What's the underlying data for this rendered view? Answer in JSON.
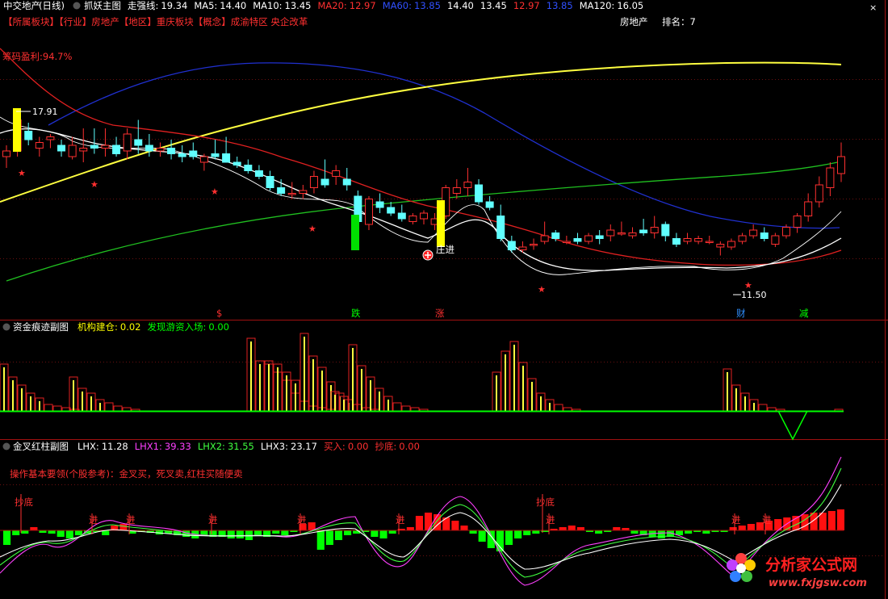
{
  "main_panel": {
    "stock_name": "中交地产",
    "period": "(日线)",
    "indicator_name": "抓妖主图",
    "stats": [
      {
        "label": "走强线:",
        "value": "19.34",
        "color": "#ffffff"
      },
      {
        "label": "MA5:",
        "value": "14.40",
        "color": "#ffffff"
      },
      {
        "label": "MA10:",
        "value": "13.45",
        "color": "#ffffff"
      },
      {
        "label": "MA20:",
        "value": "12.97",
        "color": "#ff3030"
      },
      {
        "label": "MA60:",
        "value": "13.85",
        "color": "#3050ff"
      },
      {
        "label": "",
        "value": "14.40",
        "color": "#ffffff"
      },
      {
        "label": "",
        "value": "13.45",
        "color": "#ffffff"
      },
      {
        "label": "",
        "value": "12.97",
        "color": "#ff3030"
      },
      {
        "label": "",
        "value": "13.85",
        "color": "#3050ff"
      },
      {
        "label": "MA120:",
        "value": "16.05",
        "color": "#ffffff"
      }
    ],
    "sectors_line": "【所属板块】【行业】房地产【地区】重庆板块【概念】成渝特区 央企改革",
    "industry": "房地产",
    "rank_label": "排名：7",
    "chip_profit": "筹码盈利:94.7%",
    "high_price_label": "17.91",
    "low_price_label": "11.50",
    "signal_label": "庄进",
    "bottom_markers": [
      {
        "text": "$",
        "color": "#ff3030"
      },
      {
        "text": "跌",
        "color": "#00ff00"
      },
      {
        "text": "涨",
        "color": "#ff3030"
      },
      {
        "text": "财",
        "color": "#3090ff"
      },
      {
        "text": "减",
        "color": "#00ff00"
      }
    ]
  },
  "fund_panel": {
    "name": "资金痕迹副图",
    "stats": [
      {
        "label": "机构建仓:",
        "value": "0.02",
        "color": "#ffff00"
      },
      {
        "label": "发现游资入场:",
        "value": "0.00",
        "color": "#00ff00"
      }
    ]
  },
  "cross_panel": {
    "name": "金叉红柱副图",
    "stats": [
      {
        "label": "LHX:",
        "value": "11.28",
        "color": "#ffffff"
      },
      {
        "label": "LHX1:",
        "value": "39.33",
        "color": "#ff40ff"
      },
      {
        "label": "LHX2:",
        "value": "31.55",
        "color": "#40ff40"
      },
      {
        "label": "LHX3:",
        "value": "23.17",
        "color": "#ffffff"
      },
      {
        "label": "买入:",
        "value": "0.00",
        "color": "#ff3030"
      },
      {
        "label": "抄底:",
        "value": "0.00",
        "color": "#ff3030"
      }
    ],
    "note": "操作基本要领(个股参考)：金叉买，死叉卖,红柱买随便卖",
    "bottom_labels": [
      "抄底",
      "抄底"
    ],
    "buy_labels": [
      "进",
      "进",
      "进",
      "进",
      "进",
      "进",
      "进",
      "进"
    ]
  },
  "watermark": {
    "name": "分析家公式网",
    "url": "www.fxjgsw.com"
  },
  "chart_data": [
    {
      "type": "candlestick",
      "title": "抓妖主图",
      "ylim": [
        11.0,
        21.0
      ],
      "candles": [
        {
          "o": 16.6,
          "h": 17.0,
          "l": 16.2,
          "c": 16.8
        },
        {
          "o": 16.8,
          "h": 17.91,
          "l": 16.6,
          "c": 17.9
        },
        {
          "o": 17.5,
          "h": 17.8,
          "l": 17.0,
          "c": 17.2
        },
        {
          "o": 16.9,
          "h": 17.3,
          "l": 16.6,
          "c": 17.1
        },
        {
          "o": 17.2,
          "h": 17.4,
          "l": 16.9,
          "c": 17.3
        },
        {
          "o": 17.0,
          "h": 17.2,
          "l": 16.6,
          "c": 16.8
        },
        {
          "o": 16.6,
          "h": 17.3,
          "l": 16.5,
          "c": 17.0
        },
        {
          "o": 16.8,
          "h": 17.6,
          "l": 16.4,
          "c": 16.9
        },
        {
          "o": 17.0,
          "h": 17.6,
          "l": 16.7,
          "c": 16.9
        },
        {
          "o": 16.9,
          "h": 17.6,
          "l": 16.6,
          "c": 17.0
        },
        {
          "o": 17.0,
          "h": 17.3,
          "l": 16.6,
          "c": 16.7
        },
        {
          "o": 16.8,
          "h": 17.6,
          "l": 16.5,
          "c": 17.4
        },
        {
          "o": 17.2,
          "h": 17.9,
          "l": 16.7,
          "c": 17.0
        },
        {
          "o": 17.0,
          "h": 17.4,
          "l": 16.6,
          "c": 16.8
        },
        {
          "o": 16.8,
          "h": 17.1,
          "l": 16.6,
          "c": 16.9
        },
        {
          "o": 16.9,
          "h": 17.2,
          "l": 16.5,
          "c": 16.7
        },
        {
          "o": 16.7,
          "h": 17.0,
          "l": 16.4,
          "c": 16.6
        },
        {
          "o": 16.8,
          "h": 17.1,
          "l": 16.5,
          "c": 16.6
        },
        {
          "o": 16.4,
          "h": 16.7,
          "l": 16.1,
          "c": 16.6
        },
        {
          "o": 16.7,
          "h": 17.2,
          "l": 16.5,
          "c": 16.6
        },
        {
          "o": 16.7,
          "h": 17.3,
          "l": 16.4,
          "c": 16.4
        },
        {
          "o": 16.4,
          "h": 16.6,
          "l": 16.2,
          "c": 16.3
        },
        {
          "o": 16.3,
          "h": 16.5,
          "l": 16.0,
          "c": 16.1
        },
        {
          "o": 16.1,
          "h": 16.3,
          "l": 15.8,
          "c": 15.9
        },
        {
          "o": 15.9,
          "h": 16.1,
          "l": 15.4,
          "c": 15.5
        },
        {
          "o": 15.5,
          "h": 15.8,
          "l": 15.2,
          "c": 15.3
        },
        {
          "o": 15.3,
          "h": 15.7,
          "l": 15.1,
          "c": 15.3
        },
        {
          "o": 15.3,
          "h": 15.6,
          "l": 15.1,
          "c": 15.4
        },
        {
          "o": 15.5,
          "h": 16.1,
          "l": 15.3,
          "c": 15.9
        },
        {
          "o": 15.8,
          "h": 16.5,
          "l": 15.5,
          "c": 15.6
        },
        {
          "o": 15.9,
          "h": 16.3,
          "l": 15.6,
          "c": 16.1
        },
        {
          "o": 15.8,
          "h": 16.2,
          "l": 15.4,
          "c": 15.6
        },
        {
          "o": 15.2,
          "h": 15.4,
          "l": 14.2,
          "c": 14.3
        },
        {
          "o": 14.2,
          "h": 15.2,
          "l": 14.0,
          "c": 15.1
        },
        {
          "o": 15.0,
          "h": 15.3,
          "l": 14.6,
          "c": 14.8
        },
        {
          "o": 14.8,
          "h": 15.0,
          "l": 14.5,
          "c": 14.6
        },
        {
          "o": 14.6,
          "h": 14.9,
          "l": 14.3,
          "c": 14.4
        },
        {
          "o": 14.3,
          "h": 14.6,
          "l": 14.2,
          "c": 14.5
        },
        {
          "o": 14.4,
          "h": 14.7,
          "l": 14.2,
          "c": 14.6
        },
        {
          "o": 14.2,
          "h": 14.6,
          "l": 14.0,
          "c": 14.4
        },
        {
          "o": 14.5,
          "h": 15.6,
          "l": 14.4,
          "c": 15.5
        },
        {
          "o": 15.3,
          "h": 15.8,
          "l": 15.1,
          "c": 15.5
        },
        {
          "o": 15.5,
          "h": 16.2,
          "l": 15.2,
          "c": 15.7
        },
        {
          "o": 15.6,
          "h": 15.8,
          "l": 14.9,
          "c": 15.0
        },
        {
          "o": 15.0,
          "h": 15.2,
          "l": 14.7,
          "c": 14.8
        },
        {
          "o": 14.5,
          "h": 14.9,
          "l": 13.6,
          "c": 13.7
        },
        {
          "o": 13.6,
          "h": 13.8,
          "l": 13.2,
          "c": 13.3
        },
        {
          "o": 13.3,
          "h": 13.6,
          "l": 13.2,
          "c": 13.4
        },
        {
          "o": 13.5,
          "h": 13.7,
          "l": 13.3,
          "c": 13.5
        },
        {
          "o": 13.6,
          "h": 14.3,
          "l": 13.5,
          "c": 13.8
        },
        {
          "o": 13.9,
          "h": 14.0,
          "l": 13.6,
          "c": 13.7
        },
        {
          "o": 13.6,
          "h": 13.8,
          "l": 13.5,
          "c": 13.6
        },
        {
          "o": 13.7,
          "h": 13.9,
          "l": 13.5,
          "c": 13.6
        },
        {
          "o": 13.6,
          "h": 13.9,
          "l": 13.5,
          "c": 13.8
        },
        {
          "o": 13.8,
          "h": 14.0,
          "l": 13.5,
          "c": 13.7
        },
        {
          "o": 13.8,
          "h": 14.2,
          "l": 13.6,
          "c": 14.0
        },
        {
          "o": 13.9,
          "h": 14.3,
          "l": 13.8,
          "c": 13.9
        },
        {
          "o": 13.8,
          "h": 14.1,
          "l": 13.7,
          "c": 13.9
        },
        {
          "o": 14.0,
          "h": 14.4,
          "l": 13.8,
          "c": 13.9
        },
        {
          "o": 13.9,
          "h": 14.5,
          "l": 13.7,
          "c": 14.1
        },
        {
          "o": 14.2,
          "h": 14.3,
          "l": 13.6,
          "c": 13.8
        },
        {
          "o": 13.7,
          "h": 13.9,
          "l": 13.4,
          "c": 13.5
        },
        {
          "o": 13.6,
          "h": 13.9,
          "l": 13.5,
          "c": 13.7
        },
        {
          "o": 13.6,
          "h": 13.8,
          "l": 13.5,
          "c": 13.7
        },
        {
          "o": 13.6,
          "h": 13.8,
          "l": 13.5,
          "c": 13.6
        },
        {
          "o": 13.4,
          "h": 13.6,
          "l": 13.1,
          "c": 13.5
        },
        {
          "o": 13.4,
          "h": 13.7,
          "l": 13.3,
          "c": 13.6
        },
        {
          "o": 13.6,
          "h": 13.9,
          "l": 13.5,
          "c": 13.8
        },
        {
          "o": 13.8,
          "h": 14.2,
          "l": 13.7,
          "c": 14.0
        },
        {
          "o": 13.9,
          "h": 14.1,
          "l": 13.6,
          "c": 13.7
        },
        {
          "o": 13.5,
          "h": 13.9,
          "l": 13.4,
          "c": 13.8
        },
        {
          "o": 13.8,
          "h": 14.2,
          "l": 13.7,
          "c": 14.1
        },
        {
          "o": 14.1,
          "h": 14.6,
          "l": 13.9,
          "c": 14.5
        },
        {
          "o": 14.5,
          "h": 15.3,
          "l": 14.3,
          "c": 15.0
        },
        {
          "o": 15.0,
          "h": 15.9,
          "l": 14.8,
          "c": 15.6
        },
        {
          "o": 15.5,
          "h": 16.4,
          "l": 15.2,
          "c": 16.2
        },
        {
          "o": 16.0,
          "h": 17.1,
          "l": 15.7,
          "c": 16.6
        }
      ]
    }
  ]
}
